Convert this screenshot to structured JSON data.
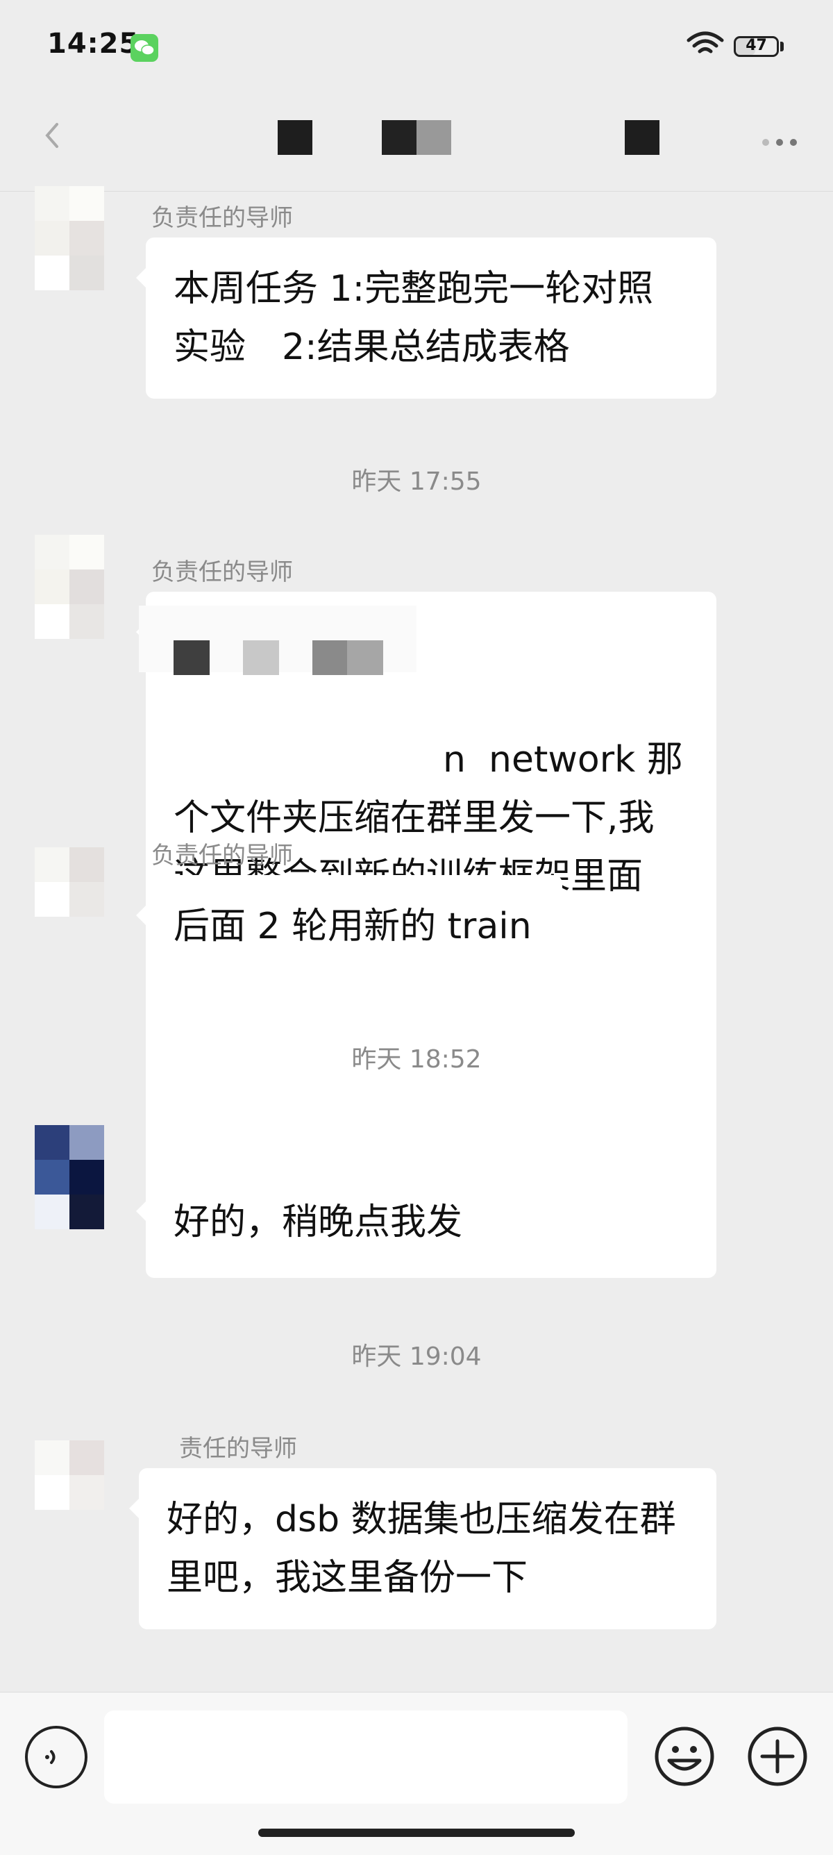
{
  "status_bar": {
    "time": "14:25",
    "battery": 47,
    "battery_label": "47",
    "colors": {
      "wechat_badge": "#5bd25f"
    }
  },
  "nav": {
    "back_icon": "chevron-left-icon",
    "more_icon": "more-dots-icon"
  },
  "messages": [
    {
      "sender": "负责任的导师",
      "text": "本周任务 1:完整跑完一轮对照实验　2:结果总结成表格"
    },
    {
      "sender": "负责任的导师",
      "text": "n  network 那个文件夹压缩在群里发一下,我这里整合到新的训练框架里面"
    },
    {
      "sender": "负责任的导师",
      "text": "后面 2 轮用新的 train"
    },
    {
      "sender": "",
      "text": "好的，稍晚点我发"
    },
    {
      "sender": "责任的导师",
      "text": "好的，dsb 数据集也压缩发在群里吧，我这里备份一下"
    }
  ],
  "timestamps": [
    "昨天 17:55",
    "昨天 18:52",
    "昨天 19:04"
  ],
  "input_bar": {
    "voice_icon": "voice-icon",
    "emoji_icon": "emoji-icon",
    "plus_icon": "plus-icon",
    "value": ""
  }
}
